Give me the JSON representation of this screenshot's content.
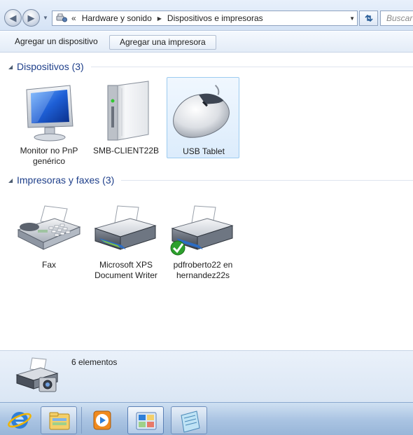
{
  "address_bar": {
    "overflow_marker": "«",
    "breadcrumbs": [
      "Hardware y sonido",
      "Dispositivos e impresoras"
    ],
    "search_placeholder": "Buscar"
  },
  "command_bar": {
    "add_device_label": "Agregar un dispositivo",
    "add_printer_label": "Agregar una impresora"
  },
  "groups": {
    "devices": {
      "title": "Dispositivos (3)",
      "items": [
        {
          "label": "Monitor no PnP genérico",
          "icon": "monitor-icon"
        },
        {
          "label": "SMB-CLIENT22B",
          "icon": "computer-tower-icon"
        },
        {
          "label": "USB Tablet",
          "icon": "mouse-icon",
          "selected": true
        }
      ]
    },
    "printers": {
      "title": "Impresoras y faxes (3)",
      "items": [
        {
          "label": "Fax",
          "icon": "fax-icon"
        },
        {
          "label": "Microsoft XPS Document Writer",
          "icon": "printer-icon"
        },
        {
          "label": "pdfroberto22 en hernandez22s",
          "icon": "default-printer-icon",
          "default": true
        }
      ]
    }
  },
  "details": {
    "count_text": "6 elementos",
    "icon": "printer-camera-icon"
  },
  "taskbar": {
    "buttons": [
      "internet-explorer-icon",
      "windows-explorer-icon",
      "media-player-icon",
      "control-panel-icon",
      "notepad-icon"
    ]
  },
  "colors": {
    "group_title": "#1e3f8a",
    "selection": "#dcecfc",
    "taskbar": "#a9c3e2",
    "default_check": "#2da02d"
  }
}
